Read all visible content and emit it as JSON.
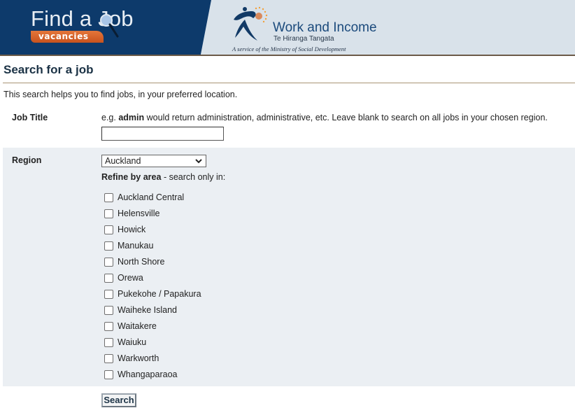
{
  "header": {
    "find_a_job_title": "Find a Job",
    "vacancies_label": "vacancies",
    "agency_name": "Work and Income",
    "agency_maori_name": "Te Hiranga Tangata",
    "agency_tagline": "A service of the Ministry of Social Development",
    "colors": {
      "banner_navy": "#0d3a6b",
      "banner_right": "#d9e2ea",
      "vacancies_orange": "#e5763a"
    }
  },
  "page": {
    "title": "Search for a job",
    "intro": "This search helps you to find jobs, in your preferred location."
  },
  "form": {
    "job_title": {
      "label": "Job Title",
      "hint_prefix": "e.g.",
      "hint_keyword": "admin",
      "hint_suffix": "would return administration, administrative, etc. Leave blank to search on all jobs in your chosen region.",
      "value": "",
      "placeholder": ""
    },
    "region": {
      "label": "Region",
      "selected": "Auckland",
      "refine_bold": "Refine by area",
      "refine_rest": " - search only in:",
      "areas": [
        {
          "label": "Auckland Central",
          "checked": false
        },
        {
          "label": "Helensville",
          "checked": false
        },
        {
          "label": "Howick",
          "checked": false
        },
        {
          "label": "Manukau",
          "checked": false
        },
        {
          "label": "North Shore",
          "checked": false
        },
        {
          "label": "Orewa",
          "checked": false
        },
        {
          "label": "Pukekohe / Papakura",
          "checked": false
        },
        {
          "label": "Waiheke Island",
          "checked": false
        },
        {
          "label": "Waitakere",
          "checked": false
        },
        {
          "label": "Waiuku",
          "checked": false
        },
        {
          "label": "Warkworth",
          "checked": false
        },
        {
          "label": "Whangaparaoa",
          "checked": false
        }
      ]
    },
    "search_label": "Search"
  }
}
